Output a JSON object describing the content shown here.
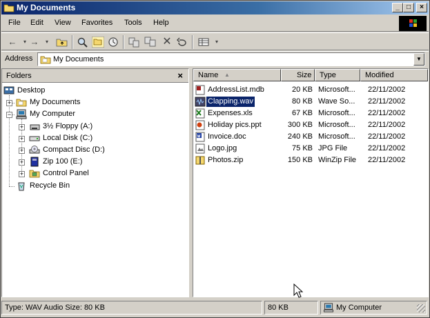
{
  "window": {
    "title": "My Documents"
  },
  "menu": [
    "File",
    "Edit",
    "View",
    "Favorites",
    "Tools",
    "Help"
  ],
  "toolbar": {
    "buttons": [
      "back-icon",
      "forward-icon",
      "up-folder-icon",
      "search-icon",
      "folders-icon",
      "history-icon",
      "move-to-icon",
      "copy-to-icon",
      "delete-icon",
      "undo-icon",
      "views-icon"
    ]
  },
  "address": {
    "label": "Address",
    "value": "My Documents"
  },
  "folders": {
    "title": "Folders",
    "close": "×",
    "tree": [
      {
        "label": "Desktop",
        "icon": "desktop-icon"
      },
      {
        "label": "My Documents",
        "icon": "my-documents-icon"
      },
      {
        "label": "My Computer",
        "icon": "my-computer-icon"
      },
      {
        "label": "3½ Floppy (A:)",
        "icon": "floppy-icon"
      },
      {
        "label": "Local Disk (C:)",
        "icon": "hard-disk-icon"
      },
      {
        "label": "Compact Disc (D:)",
        "icon": "cd-drive-icon"
      },
      {
        "label": "Zip 100  (E:)",
        "icon": "zip-drive-icon"
      },
      {
        "label": "Control Panel",
        "icon": "control-panel-icon"
      },
      {
        "label": "Recycle Bin",
        "icon": "recycle-bin-icon"
      }
    ]
  },
  "files": {
    "columns": {
      "name": "Name",
      "size": "Size",
      "type": "Type",
      "modified": "Modified"
    },
    "rows": [
      {
        "name": "AddressList.mdb",
        "size": "20 KB",
        "type": "Microsoft...",
        "modified": "22/11/2002",
        "icon": "access-file-icon"
      },
      {
        "name": "Clapping.wav",
        "size": "80 KB",
        "type": "Wave So...",
        "modified": "22/11/2002",
        "icon": "wave-file-icon"
      },
      {
        "name": "Expenses.xls",
        "size": "67 KB",
        "type": "Microsoft...",
        "modified": "22/11/2002",
        "icon": "excel-file-icon"
      },
      {
        "name": "Holiday pics.ppt",
        "size": "300 KB",
        "type": "Microsoft...",
        "modified": "22/11/2002",
        "icon": "powerpoint-file-icon"
      },
      {
        "name": "Invoice.doc",
        "size": "240 KB",
        "type": "Microsoft...",
        "modified": "22/11/2002",
        "icon": "word-file-icon"
      },
      {
        "name": "Logo.jpg",
        "size": "75 KB",
        "type": "JPG File",
        "modified": "22/11/2002",
        "icon": "image-file-icon"
      },
      {
        "name": "Photos.zip",
        "size": "150 KB",
        "type": "WinZip File",
        "modified": "22/11/2002",
        "icon": "zip-file-icon"
      }
    ],
    "selected": "Clapping.wav"
  },
  "status": {
    "info": "Type: WAV Audio Size: 80 KB",
    "size": "80 KB",
    "zone": "My Computer"
  },
  "colors": {
    "title_start": "#0a246a",
    "title_end": "#a6caf0",
    "chrome": "#d4d0c8",
    "selection": "#0a246a"
  }
}
